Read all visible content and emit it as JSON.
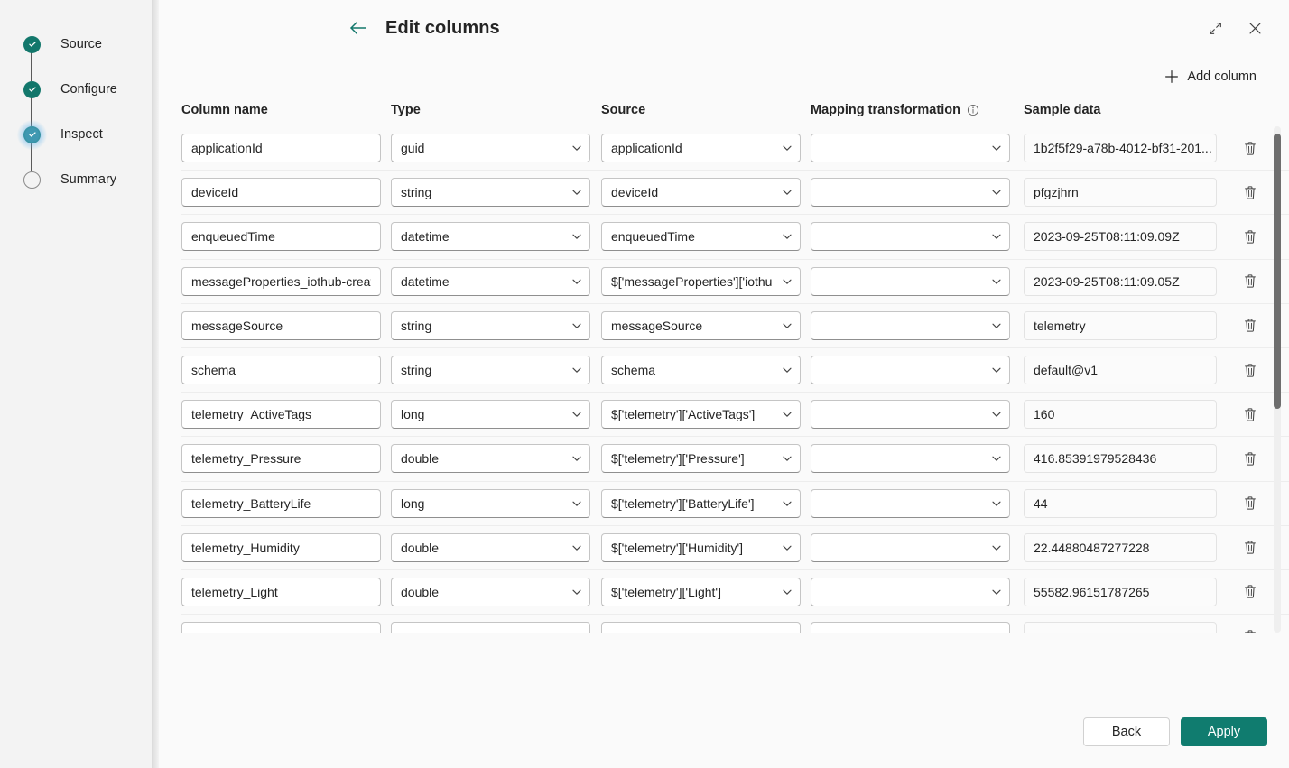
{
  "accent": {
    "teal": "#107c6f",
    "step_done": "#12776b",
    "text": "#242424",
    "sidebar_bg": "#f3f3f3",
    "panel_bg": "#fafafa"
  },
  "sidebar": {
    "steps": [
      {
        "label": "Source",
        "state": "done"
      },
      {
        "label": "Configure",
        "state": "done"
      },
      {
        "label": "Inspect",
        "state": "current"
      },
      {
        "label": "Summary",
        "state": "todo"
      }
    ]
  },
  "header": {
    "title": "Edit columns",
    "back_icon": "arrow-left-icon",
    "expand_icon": "expand-diagonal-icon",
    "close_icon": "close-icon"
  },
  "toolbar": {
    "add_column_label": "Add column",
    "add_icon": "plus-icon"
  },
  "grid": {
    "headers": {
      "column_name": "Column name",
      "type": "Type",
      "source": "Source",
      "mapping_transformation": "Mapping transformation",
      "mapping_info_icon": "info-icon",
      "sample_data": "Sample data"
    },
    "delete_icon": "trash-icon",
    "chevron_icon": "chevron-down-icon",
    "rows": [
      {
        "column_name": "applicationId",
        "type": "guid",
        "source": "applicationId",
        "mapping_transformation": "",
        "sample_data": "1b2f5f29-a78b-4012-bf31-201..."
      },
      {
        "column_name": "deviceId",
        "type": "string",
        "source": "deviceId",
        "mapping_transformation": "",
        "sample_data": "pfgzjhrn"
      },
      {
        "column_name": "enqueuedTime",
        "type": "datetime",
        "source": "enqueuedTime",
        "mapping_transformation": "",
        "sample_data": "2023-09-25T08:11:09.09Z"
      },
      {
        "column_name": "messageProperties_iothub-creat",
        "type": "datetime",
        "source": "$['messageProperties']['iothu",
        "mapping_transformation": "",
        "sample_data": "2023-09-25T08:11:09.05Z"
      },
      {
        "column_name": "messageSource",
        "type": "string",
        "source": "messageSource",
        "mapping_transformation": "",
        "sample_data": "telemetry"
      },
      {
        "column_name": "schema",
        "type": "string",
        "source": "schema",
        "mapping_transformation": "",
        "sample_data": "default@v1"
      },
      {
        "column_name": "telemetry_ActiveTags",
        "type": "long",
        "source": "$['telemetry']['ActiveTags']",
        "mapping_transformation": "",
        "sample_data": "160"
      },
      {
        "column_name": "telemetry_Pressure",
        "type": "double",
        "source": "$['telemetry']['Pressure']",
        "mapping_transformation": "",
        "sample_data": "416.85391979528436"
      },
      {
        "column_name": "telemetry_BatteryLife",
        "type": "long",
        "source": "$['telemetry']['BatteryLife']",
        "mapping_transformation": "",
        "sample_data": "44"
      },
      {
        "column_name": "telemetry_Humidity",
        "type": "double",
        "source": "$['telemetry']['Humidity']",
        "mapping_transformation": "",
        "sample_data": "22.44880487277228"
      },
      {
        "column_name": "telemetry_Light",
        "type": "double",
        "source": "$['telemetry']['Light']",
        "mapping_transformation": "",
        "sample_data": "55582.96151787265"
      },
      {
        "column_name": "",
        "type": "",
        "source": "",
        "mapping_transformation": "",
        "sample_data": ""
      }
    ]
  },
  "footer": {
    "back_label": "Back",
    "apply_label": "Apply"
  }
}
